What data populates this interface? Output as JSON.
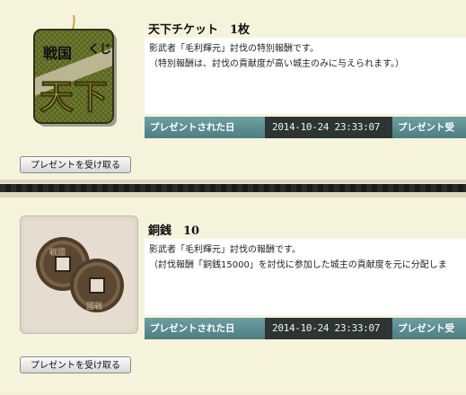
{
  "presents": [
    {
      "title": "天下チケット　1枚",
      "icon": "tenka-ticket-icon",
      "icon_text": {
        "top": "戦国",
        "kuji": "くじ",
        "main": "天下"
      },
      "description_lines": [
        "影武者「毛利輝元」討伐の特別報酬です。",
        "（特別報酬は、討伐の貢献度が高い城主のみに与えられます。）"
      ],
      "date_label": "プレゼントされた日",
      "date_value": "2014-10-24 23:33:07",
      "date_label_2": "プレゼント受",
      "button_label": "プレゼントを受け取る"
    },
    {
      "title": "銅銭　10",
      "icon": "copper-coins-icon",
      "coin_text": {
        "a": "戦國",
        "b": "國戦"
      },
      "description_lines": [
        "影武者「毛利輝元」討伐の報酬です。",
        "（討伐報酬「銅銭15000」を討伐に参加した城主の貢献度を元に分配しま"
      ],
      "date_label": "プレゼントされた日",
      "date_value": "2014-10-24 23:33:07",
      "date_label_2": "プレゼント受",
      "button_label": "プレゼントを受け取る"
    }
  ],
  "colors": {
    "background": "#f6f3dc",
    "date_label_bg": "#5f9294",
    "date_value_bg": "#2c3533"
  }
}
